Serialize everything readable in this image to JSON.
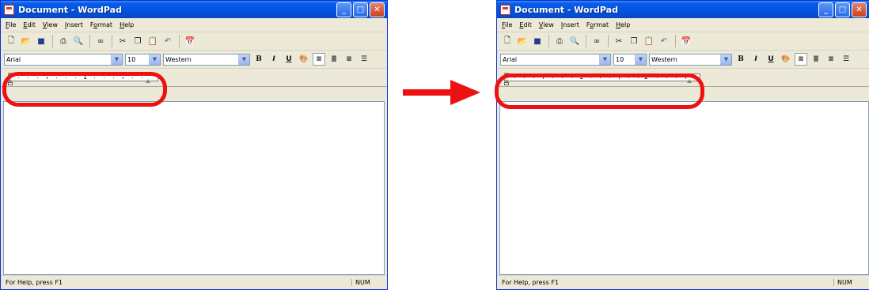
{
  "window": {
    "title": "Document - WordPad",
    "minimize_glyph": "_",
    "maximize_glyph": "□",
    "close_glyph": "✕"
  },
  "menu": {
    "items": [
      {
        "accel": "F",
        "rest": "ile"
      },
      {
        "accel": "E",
        "rest": "dit"
      },
      {
        "accel": "V",
        "rest": "iew"
      },
      {
        "accel": "I",
        "rest": "nsert"
      },
      {
        "accel": "",
        "rest": "F",
        "accel2": "o",
        "rest2": "rmat"
      },
      {
        "accel": "H",
        "rest": "elp"
      }
    ]
  },
  "toolbar": {
    "new_icon": "new-document-icon",
    "open_icon": "open-folder-icon",
    "save_icon": "save-disk-icon",
    "print_icon": "printer-icon",
    "preview_icon": "print-preview-icon",
    "find_icon": "binoculars-icon",
    "cut_icon": "scissors-icon",
    "copy_icon": "copy-icon",
    "paste_icon": "paste-icon",
    "undo_icon": "undo-icon",
    "datetime_icon": "date-time-icon"
  },
  "format": {
    "font_value": "Arial",
    "size_value": "10",
    "script_value": "Western",
    "bold": "B",
    "italic": "I",
    "underline": "U"
  },
  "ruler_left": {
    "numbers": [
      "1"
    ]
  },
  "ruler_right": {
    "numbers": [
      "1",
      "2"
    ]
  },
  "status": {
    "help_text": "For Help, press F1",
    "num_indicator": "NUM"
  },
  "colors": {
    "titlebar": "#0054e3",
    "window_face": "#ece9d8",
    "highlight": "#ee1111"
  }
}
